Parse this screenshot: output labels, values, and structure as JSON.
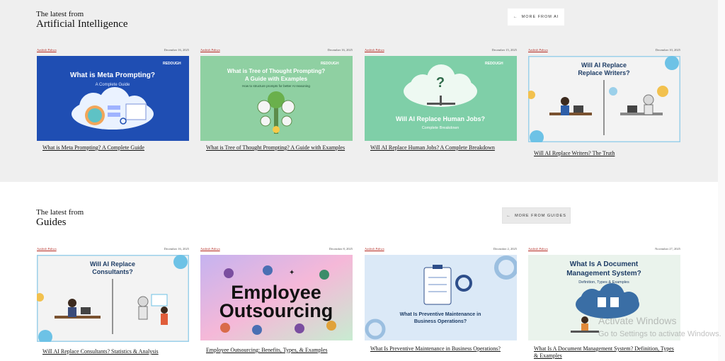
{
  "sections": [
    {
      "kicker": "The latest from",
      "title": "Artificial Intelligence",
      "more_label": "MORE FROM AI",
      "cards": [
        {
          "author": "Aashish Pahwa",
          "date": "December 16, 2025",
          "title": "What is Meta Prompting? A Complete Guide",
          "thumb_title": "What is Meta Prompting?",
          "thumb_sub": "A Complete Guide",
          "thumb_brand": "REDOUGH",
          "bg": "#1f4eb3"
        },
        {
          "author": "Aashish Pahwa",
          "date": "December 16, 2025",
          "title": "What is Tree of Thought Prompting? A Guide with Examples",
          "thumb_title": "What is Tree of Thought Prompting?",
          "thumb_title2": "A Guide with Examples",
          "thumb_sub": "How to structure prompts for better AI reasoning",
          "thumb_brand": "REDOUGH",
          "bg": "#8fd0a2"
        },
        {
          "author": "Aashish Pahwa",
          "date": "December 15, 2025",
          "title": "Will AI Replace Human Jobs? A Complete Breakdown",
          "thumb_title": "Will AI Replace Human Jobs?",
          "thumb_sub": "Complete Breakdown",
          "thumb_brand": "REDOUGH",
          "bg": "#7fcfa8"
        },
        {
          "author": "Aashish Pahwa",
          "date": "December 10, 2025",
          "title": "Will AI Replace Writers? The Truth",
          "thumb_title": "Will AI Replace",
          "thumb_title2": "Replace Writers?",
          "bg": "#f3f3f3"
        }
      ]
    },
    {
      "kicker": "The latest from",
      "title": "Guides",
      "more_label": "MORE FROM GUIDES",
      "cards": [
        {
          "author": "Aashish Pahwa",
          "date": "December 16, 2025",
          "title": "Will AI Replace Consultants? Statistics & Analysis",
          "thumb_title": "Will AI Replace",
          "thumb_title2": "Consultants?",
          "bg": "#f3f3f3"
        },
        {
          "author": "Aashish Pahwa",
          "date": "December 8, 2025",
          "title": "Employee Outsourcing: Benefits, Types, & Examples",
          "thumb_title": "Employee",
          "thumb_title2": "Outsourcing",
          "bg": "#f2c7e6"
        },
        {
          "author": "Aashish Pahwa",
          "date": "December 2, 2025",
          "title": "What Is Preventive Maintenance in Business Operations?",
          "thumb_title": "What Is Preventive Maintenance in",
          "thumb_title2": "Business Operations?",
          "bg": "#dbe9f7"
        },
        {
          "author": "Aashish Pahwa",
          "date": "November 27, 2025",
          "title": "What Is A Document Management System? Definition, Types & Examples",
          "thumb_title": "What Is A Document",
          "thumb_title2": "Management System?",
          "thumb_sub": "Definition, Types & Examples",
          "bg": "#eaf3ec"
        }
      ]
    }
  ],
  "watermark": {
    "line1": "Activate Windows",
    "line2": "Go to Settings to activate Windows."
  }
}
